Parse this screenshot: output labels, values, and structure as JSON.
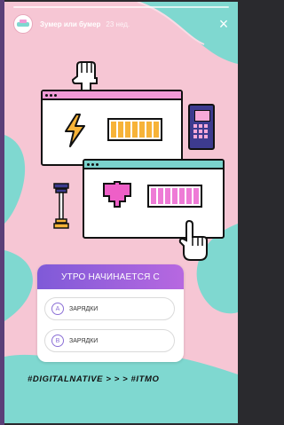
{
  "story": {
    "account_name": "Зумер или бумер",
    "time": "23 нед.",
    "close_symbol": "×"
  },
  "quiz": {
    "question": "УТРО НАЧИНАЕТСЯ С",
    "options": [
      {
        "letter": "A",
        "text": "ЗАРЯДКИ"
      },
      {
        "letter": "B",
        "text": "ЗАРЯДКИ"
      }
    ]
  },
  "hashtag": "#DIGITALNATIVE > > > #ITMO",
  "icons": [
    "pointer-hand-icon",
    "lightning-icon",
    "battery-icon",
    "mobile-phone-icon",
    "dumbbell-icon",
    "heart-icon"
  ],
  "colors": {
    "background": "#f6c6d4",
    "wave": "#7fd8d0",
    "quiz_gradient_start": "#7f5ad8",
    "quiz_gradient_end": "#b768e0",
    "battery_yellow": "#f7b338",
    "battery_pink": "#ee7bd6"
  }
}
